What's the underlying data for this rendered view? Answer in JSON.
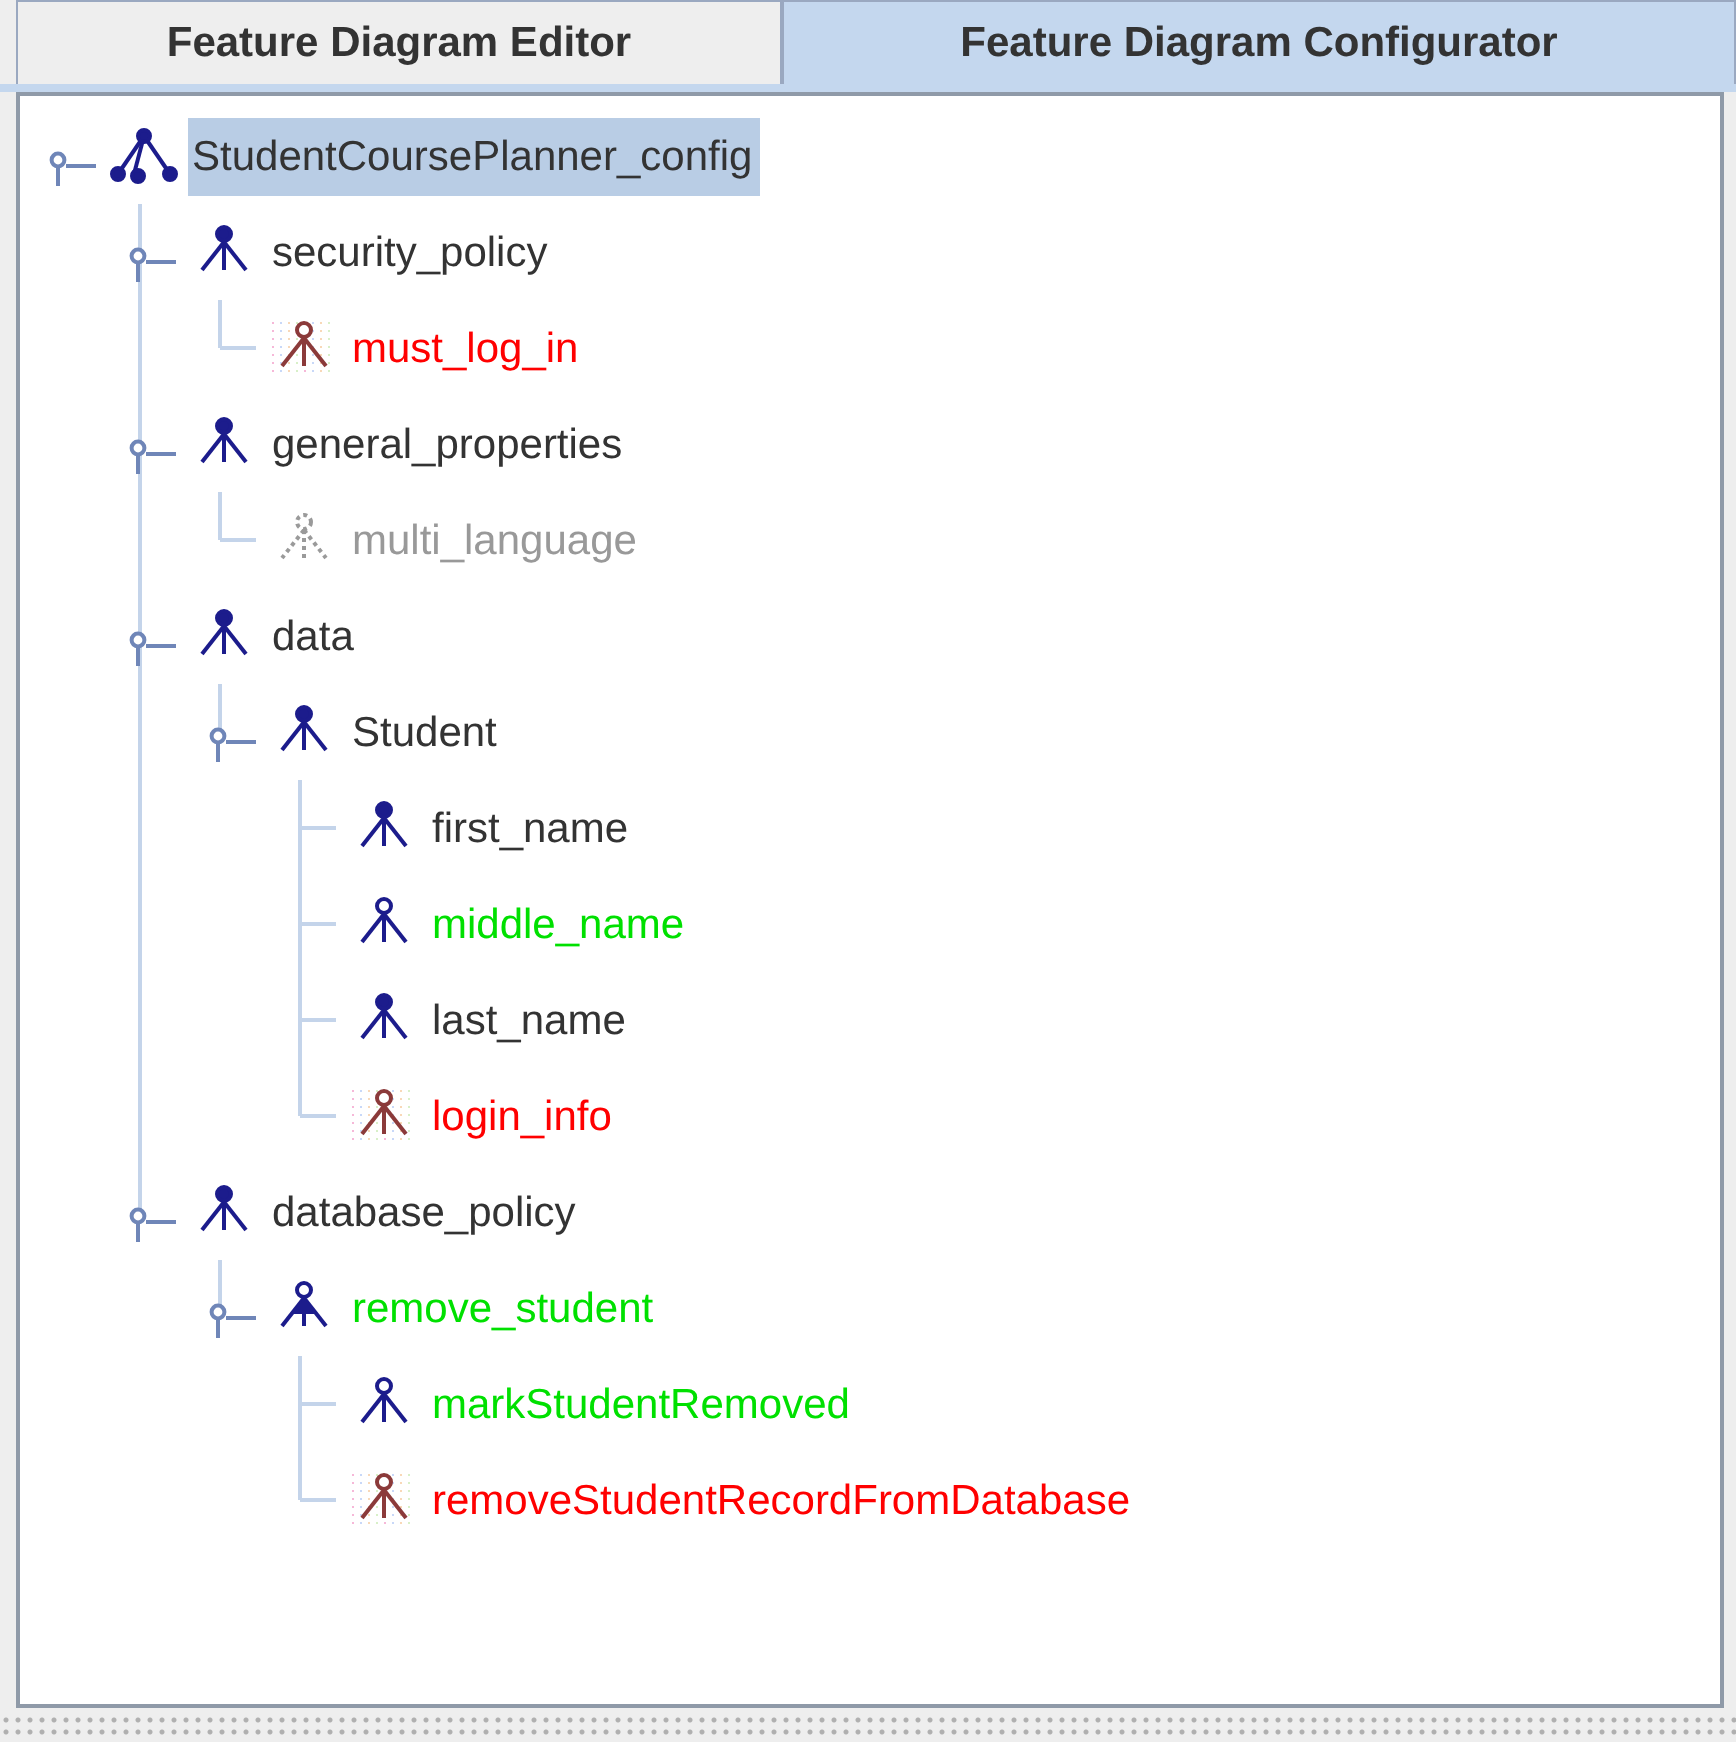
{
  "tabs": [
    {
      "label": "Feature Diagram Editor",
      "selected": false
    },
    {
      "label": "Feature Diagram Configurator",
      "selected": true
    }
  ],
  "tree": {
    "label": "StudentCoursePlanner_config",
    "kind": "root",
    "color": "#333333",
    "selected": true,
    "expanded": true,
    "children": [
      {
        "label": "security_policy",
        "kind": "mandatory",
        "color": "#333333",
        "selected": false,
        "expanded": true,
        "children": [
          {
            "label": "must_log_in",
            "kind": "excluded",
            "color": "#ff0000",
            "selected": false
          }
        ]
      },
      {
        "label": "general_properties",
        "kind": "mandatory",
        "color": "#333333",
        "selected": false,
        "expanded": true,
        "children": [
          {
            "label": "multi_language",
            "kind": "unavailable",
            "color": "#999999",
            "selected": false
          }
        ]
      },
      {
        "label": "data",
        "kind": "mandatory",
        "color": "#333333",
        "selected": false,
        "expanded": true,
        "children": [
          {
            "label": "Student",
            "kind": "mandatory",
            "color": "#333333",
            "selected": false,
            "expanded": true,
            "children": [
              {
                "label": "first_name",
                "kind": "mandatory",
                "color": "#333333",
                "selected": false
              },
              {
                "label": "middle_name",
                "kind": "optional",
                "color": "#00e000",
                "selected": false
              },
              {
                "label": "last_name",
                "kind": "mandatory",
                "color": "#333333",
                "selected": false
              },
              {
                "label": "login_info",
                "kind": "excluded",
                "color": "#ff0000",
                "selected": false
              }
            ]
          }
        ]
      },
      {
        "label": "database_policy",
        "kind": "mandatory",
        "color": "#333333",
        "selected": false,
        "expanded": true,
        "children": [
          {
            "label": "remove_student",
            "kind": "or_group",
            "color": "#00e000",
            "selected": false,
            "expanded": true,
            "children": [
              {
                "label": "markStudentRemoved",
                "kind": "optional",
                "color": "#00e000",
                "selected": false
              },
              {
                "label": "removeStudentRecordFromDatabase",
                "kind": "excluded",
                "color": "#ff0000",
                "selected": false
              }
            ]
          }
        ]
      }
    ]
  }
}
